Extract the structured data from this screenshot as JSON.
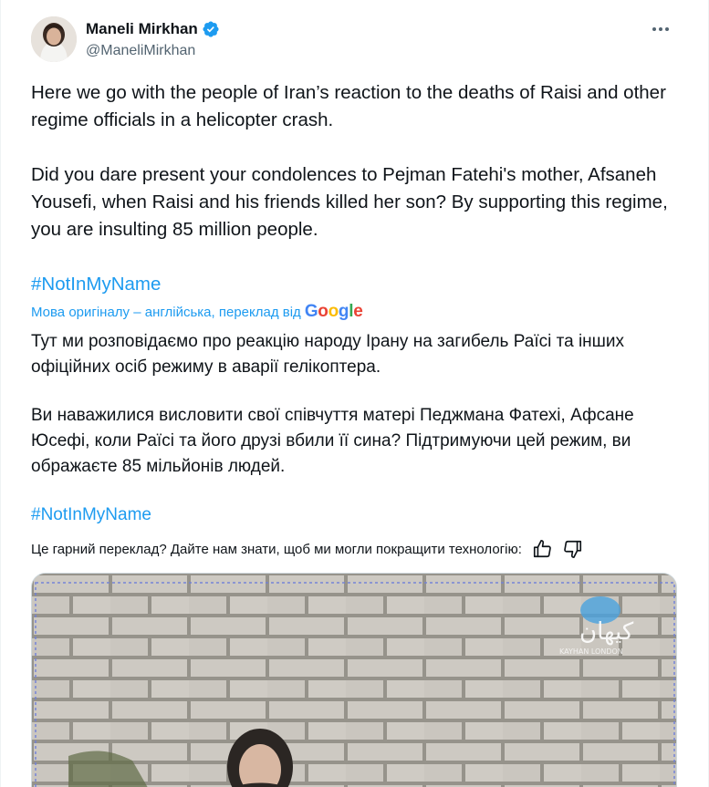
{
  "author": {
    "name": "Maneli Mirkhan",
    "handle": "@ManeliMirkhan",
    "verified_color": "#1d9bf0",
    "avatar_icon": "avatar"
  },
  "tweet": {
    "paragraph1": "Here we go with the people of Iran’s reaction to the deaths of Raisi and other regime officials in a helicopter crash.",
    "paragraph2": "Did you dare present your condolences to Pejman Fatehi's mother, Afsaneh Yousefi, when Raisi and his friends killed her son? By supporting this regime, you are insulting 85 million people.",
    "hashtag": "#NotInMyName"
  },
  "translation": {
    "notice": "Мова оригіналу – англійська, переклад від",
    "provider": "Google",
    "paragraph1": "Тут ми розповідаємо про реакцію народу Ірану на загибель Раїсі та інших офіційних осіб режиму в аварії гелікоптера.",
    "paragraph2": "Ви наважилися висловити свої співчуття матері Педжмана Фатехі, Афсане Юсефі, коли Раїсі та його друзі вбили її сина? Підтримуючи цей режим, ви ображаєте 85 мільйонів людей.",
    "hashtag": "#NotInMyName",
    "feedback_prompt": "Це гарний переклад? Дайте нам знати, щоб ми могли покращити технологію:"
  },
  "media": {
    "watermark": "کیهان",
    "watermark_sub": "KAYHAN LONDON"
  },
  "colors": {
    "accent": "#1d9bf0",
    "text": "#0f1419",
    "secondary": "#536471"
  }
}
